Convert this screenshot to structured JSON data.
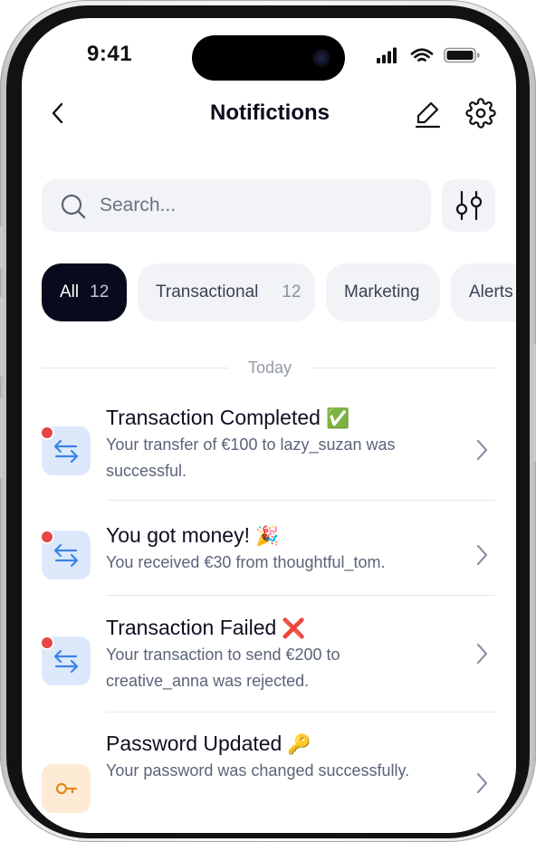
{
  "status_bar": {
    "time": "9:41"
  },
  "nav": {
    "title": "Notifictions"
  },
  "search": {
    "placeholder": "Search..."
  },
  "chips": [
    {
      "label": "All",
      "count": "12"
    },
    {
      "label": "Transactional",
      "count": "12"
    },
    {
      "label": "Marketing",
      "count": ""
    },
    {
      "label": "Alerts",
      "count": ""
    }
  ],
  "section": {
    "label": "Today"
  },
  "notifications": [
    {
      "title": "Transaction Completed",
      "emoji": "✅",
      "body": "Your transfer of €100 to lazy_suzan was successful.",
      "icon": "transfer-arrows-icon",
      "unread": true
    },
    {
      "title": "You got money!",
      "emoji": "🎉",
      "body": "You received €30  from thoughtful_tom.",
      "icon": "transfer-arrows-icon",
      "unread": true
    },
    {
      "title": "Transaction Failed",
      "emoji": "❌",
      "body": "Your transaction to send €200 to creative_anna was rejected.",
      "icon": "transfer-arrows-icon",
      "unread": true
    },
    {
      "title": "Password Updated",
      "emoji": "🔑",
      "body": "Your password was changed successfully.",
      "icon": "key-icon",
      "unread": false
    }
  ],
  "colors": {
    "accent": "#080b1d",
    "unread_dot": "#e74646",
    "icon_bg": "#dce9fb",
    "icon_fg": "#3b82e6",
    "chip_bg": "#f1f3f6"
  }
}
